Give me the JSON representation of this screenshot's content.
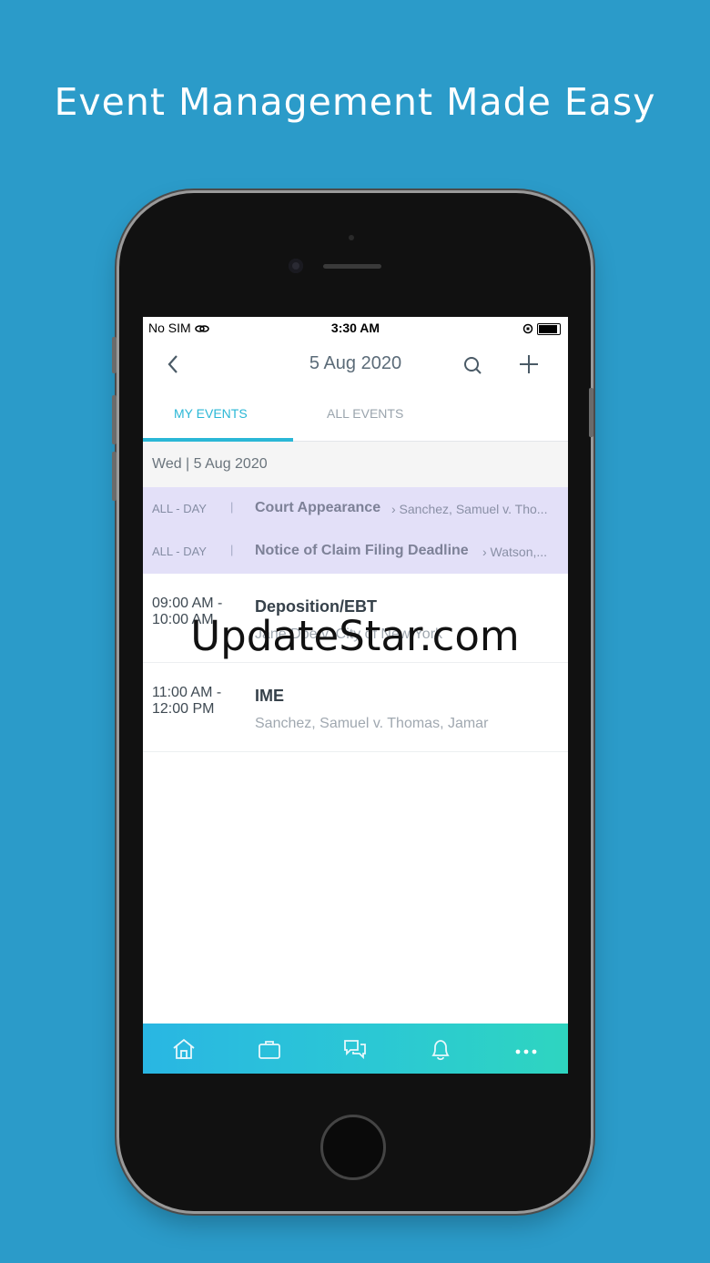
{
  "headline": "Event Management Made Easy",
  "status": {
    "carrier": "No SIM",
    "time": "3:30 AM"
  },
  "nav": {
    "title": "5 Aug 2020"
  },
  "tabs": {
    "my": "MY EVENTS",
    "all": "ALL EVENTS"
  },
  "date_header": "Wed | 5 Aug 2020",
  "allday": [
    {
      "tag": "ALL - DAY",
      "sep": "|",
      "title": "Court Appearance",
      "sub": "› Sanchez, Samuel v. Tho..."
    },
    {
      "tag": "ALL - DAY",
      "sep": "|",
      "title": "Notice of Claim Filing Deadline",
      "sub": "› Watson,..."
    }
  ],
  "events": [
    {
      "time1": "09:00 AM -",
      "time2": "10:00 AM",
      "title": "Deposition/EBT",
      "sub": "Jane Doe v. City of New York"
    },
    {
      "time1": "11:00 AM -",
      "time2": "12:00 PM",
      "title": "IME",
      "sub": "Sanchez, Samuel v. Thomas, Jamar"
    }
  ],
  "watermark": "UpdateStar.com",
  "colors": {
    "background": "#2b9bc9",
    "accent": "#2ab7d6",
    "allday_bg": "#e3e0f8"
  }
}
